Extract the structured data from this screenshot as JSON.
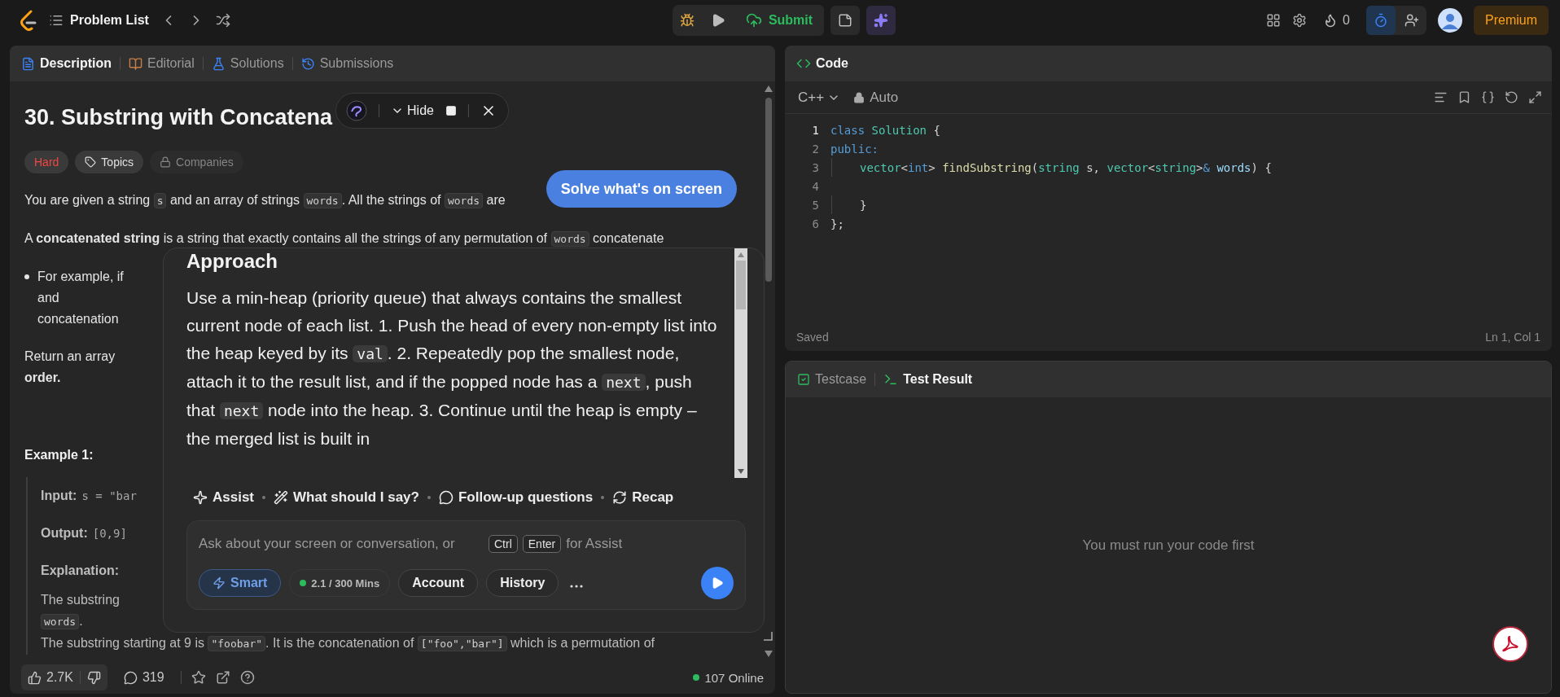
{
  "top_bar": {
    "problem_list": "Problem List",
    "submit": "Submit",
    "streak": "0",
    "premium": "Premium"
  },
  "left_tabs": [
    {
      "label": "Description",
      "kind": "description",
      "selected": true
    },
    {
      "label": "Editorial",
      "kind": "editorial",
      "selected": false
    },
    {
      "label": "Solutions",
      "kind": "solutions",
      "selected": false
    },
    {
      "label": "Submissions",
      "kind": "submissions",
      "selected": false
    }
  ],
  "problem": {
    "title": "30. Substring with Concatena",
    "difficulty": "Hard",
    "tags": [
      {
        "label": "Topics",
        "locked": false
      },
      {
        "label": "Companies",
        "locked": true
      }
    ],
    "blocks": [
      {
        "kind": "paragraph",
        "parts": [
          {
            "text": "You are given a string ",
            "kind": "text"
          },
          {
            "text": "s",
            "kind": "code"
          },
          {
            "text": " and an array of strings ",
            "kind": "text"
          },
          {
            "text": "words",
            "kind": "code"
          },
          {
            "text": ". All the strings of ",
            "kind": "text"
          },
          {
            "text": "words",
            "kind": "code"
          },
          {
            "text": " are",
            "kind": "text"
          }
        ]
      },
      {
        "kind": "paragraph",
        "parts": [
          {
            "text": "A ",
            "kind": "text"
          },
          {
            "text": "concatenated string",
            "kind": "bold"
          },
          {
            "text": " is a string that exactly contains all the strings of any permutation of ",
            "kind": "text"
          },
          {
            "text": "words",
            "kind": "code"
          },
          {
            "text": " concatenate",
            "kind": "text"
          }
        ]
      },
      {
        "kind": "lines",
        "bullet": true,
        "lines": [
          {
            "text": "For example, if",
            "bold": false
          },
          {
            "text": "and",
            "bold": false
          },
          {
            "text": "concatenation",
            "bold": false
          }
        ]
      },
      {
        "kind": "lines",
        "bullet": false,
        "lines": [
          {
            "text": "Return an array",
            "bold": false
          },
          {
            "text": "order.",
            "bold": true
          }
        ]
      },
      {
        "kind": "heading",
        "text": "Example 1:"
      },
      {
        "kind": "example",
        "rows": [
          {
            "label": "Input:",
            "value": "s = \"bar"
          },
          {
            "label": "Output:",
            "value": "[0,9]"
          },
          {
            "label": "Explanation:"
          }
        ],
        "explanation": [
          [
            {
              "text": "The substring",
              "kind": "text"
            }
          ],
          [
            {
              "text": "words",
              "kind": "code"
            },
            {
              "text": ".",
              "kind": "text"
            }
          ],
          [
            {
              "text": "The substring starting at 9 is ",
              "kind": "text"
            },
            {
              "text": "\"foobar\"",
              "kind": "code"
            },
            {
              "text": ". It is the concatenation of ",
              "kind": "text"
            },
            {
              "text": "[\"foo\",\"bar\"]",
              "kind": "code"
            },
            {
              "text": " which is a permutation of",
              "kind": "text"
            }
          ]
        ]
      }
    ]
  },
  "bottom_bar": {
    "likes": "2.7K",
    "comments": "319",
    "online": "107 Online"
  },
  "assistant": {
    "hide": "Hide",
    "solve_button": "Solve what's on screen",
    "heading": "Approach",
    "body": [
      {
        "text": "Use a min-heap (priority queue) that always contains the smallest current node of each list. 1. Push the head of every non-empty list into the heap keyed by its ",
        "kind": "text"
      },
      {
        "text": "val",
        "kind": "code"
      },
      {
        "text": ". 2. Repeatedly pop the smallest node, attach it to the result list, and if the popped node has a ",
        "kind": "text"
      },
      {
        "text": "next",
        "kind": "code"
      },
      {
        "text": ", push that ",
        "kind": "text"
      },
      {
        "text": "next",
        "kind": "code"
      },
      {
        "text": " node into the heap. 3. Continue until the heap is empty – the merged list is built in",
        "kind": "text"
      }
    ],
    "actions": [
      {
        "label": "Assist",
        "kind": "assist"
      },
      {
        "label": "What should I say?",
        "kind": "suggest"
      },
      {
        "label": "Follow-up questions",
        "kind": "followup"
      },
      {
        "label": "Recap",
        "kind": "recap"
      }
    ],
    "input": {
      "placeholder": "Ask about your screen or conversation, or",
      "keys": [
        "Ctrl",
        "Enter"
      ],
      "suffix": "for Assist"
    },
    "mode": {
      "label": "Smart",
      "selected": true
    },
    "usage": "2.1 / 300 Mins",
    "buttons": [
      "Account",
      "History"
    ]
  },
  "code": {
    "title": "Code",
    "language": "C++",
    "mode": "Auto",
    "status": "Saved",
    "position": "Ln 1, Col 1",
    "lines": [
      {
        "num": "1",
        "current": true,
        "indented": false,
        "tokens": [
          {
            "text": "class ",
            "kind": "keyword"
          },
          {
            "text": "Solution",
            "kind": "type"
          },
          {
            "text": " {",
            "kind": "plain"
          }
        ]
      },
      {
        "num": "2",
        "current": false,
        "indented": false,
        "tokens": [
          {
            "text": "public:",
            "kind": "keyword"
          }
        ]
      },
      {
        "num": "3",
        "current": false,
        "indented": true,
        "tokens": [
          {
            "text": "vector",
            "kind": "type"
          },
          {
            "text": "<",
            "kind": "plain"
          },
          {
            "text": "int",
            "kind": "keyword"
          },
          {
            "text": "> ",
            "kind": "plain"
          },
          {
            "text": "findSubstring",
            "kind": "func"
          },
          {
            "text": "(",
            "kind": "plain"
          },
          {
            "text": "string",
            "kind": "type"
          },
          {
            "text": " s, ",
            "kind": "plain"
          },
          {
            "text": "vector",
            "kind": "type"
          },
          {
            "text": "<",
            "kind": "plain"
          },
          {
            "text": "string",
            "kind": "type"
          },
          {
            "text": ">",
            "kind": "plain"
          },
          {
            "text": "& ",
            "kind": "keyword"
          },
          {
            "text": "words",
            "kind": "param"
          },
          {
            "text": ") {",
            "kind": "plain"
          }
        ]
      },
      {
        "num": "4",
        "current": false,
        "indented": false
      },
      {
        "num": "5",
        "current": false,
        "indented": true,
        "tokens": [
          {
            "text": "}",
            "kind": "plain"
          }
        ]
      },
      {
        "num": "6",
        "current": false,
        "indented": false,
        "tokens": [
          {
            "text": "};",
            "kind": "plain"
          }
        ]
      }
    ]
  },
  "test": {
    "tabs": [
      {
        "label": "Testcase",
        "selected": false
      },
      {
        "label": "Test Result",
        "selected": true
      }
    ],
    "message": "You must run your code first"
  }
}
